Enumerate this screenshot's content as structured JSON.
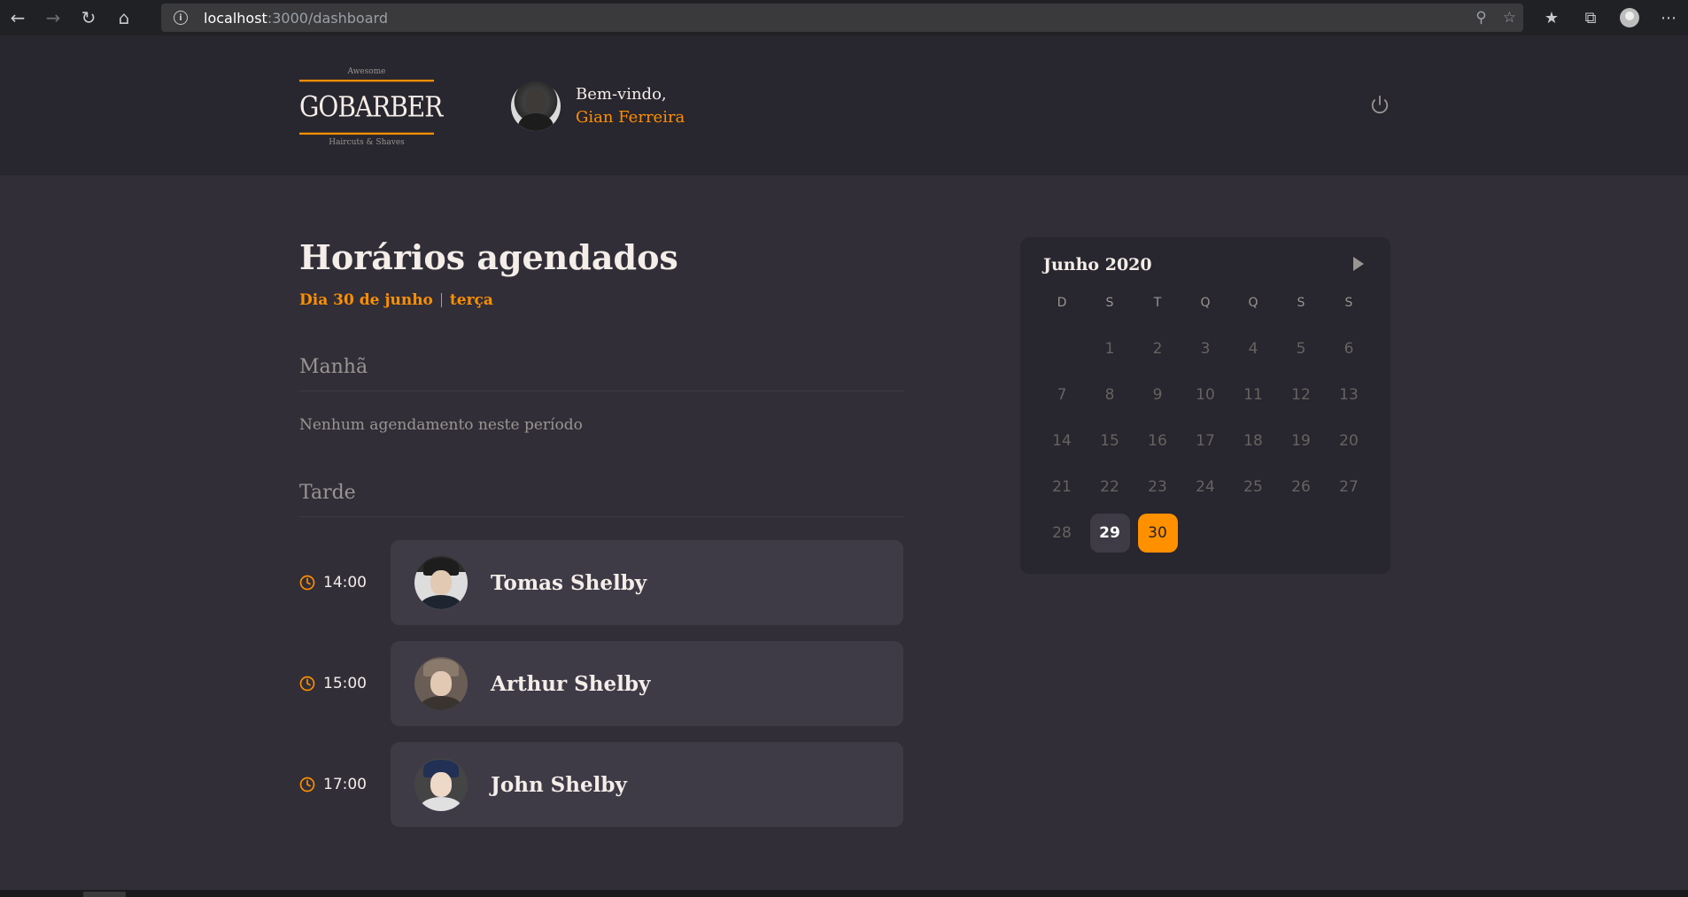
{
  "browser": {
    "url_host": "localhost",
    "url_path": ":3000/dashboard"
  },
  "logo": {
    "top_text": "Awesome",
    "brand": "GOBARBER",
    "bottom_text": "Haircuts & Shaves"
  },
  "header": {
    "greeting": "Bem-vindo,",
    "user_name": "Gian Ferreira"
  },
  "main": {
    "title": "Horários agendados",
    "date_label": "Dia 30 de junho",
    "weekday_label": "terça",
    "morning": {
      "title": "Manhã",
      "empty_message": "Nenhum agendamento neste período"
    },
    "afternoon": {
      "title": "Tarde",
      "appointments": [
        {
          "time": "14:00",
          "name": "Tomas Shelby"
        },
        {
          "time": "15:00",
          "name": "Arthur Shelby"
        },
        {
          "time": "17:00",
          "name": "John Shelby"
        }
      ]
    }
  },
  "calendar": {
    "month_label": "Junho 2020",
    "weekdays": [
      "D",
      "S",
      "T",
      "Q",
      "Q",
      "S",
      "S"
    ],
    "days": [
      {
        "n": "",
        "state": "blank"
      },
      {
        "n": "1",
        "state": "disabled"
      },
      {
        "n": "2",
        "state": "disabled"
      },
      {
        "n": "3",
        "state": "disabled"
      },
      {
        "n": "4",
        "state": "disabled"
      },
      {
        "n": "5",
        "state": "disabled"
      },
      {
        "n": "6",
        "state": "disabled"
      },
      {
        "n": "7",
        "state": "disabled"
      },
      {
        "n": "8",
        "state": "disabled"
      },
      {
        "n": "9",
        "state": "disabled"
      },
      {
        "n": "10",
        "state": "disabled"
      },
      {
        "n": "11",
        "state": "disabled"
      },
      {
        "n": "12",
        "state": "disabled"
      },
      {
        "n": "13",
        "state": "disabled"
      },
      {
        "n": "14",
        "state": "disabled"
      },
      {
        "n": "15",
        "state": "disabled"
      },
      {
        "n": "16",
        "state": "disabled"
      },
      {
        "n": "17",
        "state": "disabled"
      },
      {
        "n": "18",
        "state": "disabled"
      },
      {
        "n": "19",
        "state": "disabled"
      },
      {
        "n": "20",
        "state": "disabled"
      },
      {
        "n": "21",
        "state": "disabled"
      },
      {
        "n": "22",
        "state": "disabled"
      },
      {
        "n": "23",
        "state": "disabled"
      },
      {
        "n": "24",
        "state": "disabled"
      },
      {
        "n": "25",
        "state": "disabled"
      },
      {
        "n": "26",
        "state": "disabled"
      },
      {
        "n": "27",
        "state": "disabled"
      },
      {
        "n": "28",
        "state": "disabled"
      },
      {
        "n": "29",
        "state": "available"
      },
      {
        "n": "30",
        "state": "selected"
      }
    ]
  },
  "colors": {
    "accent": "#ff9000",
    "background": "#312e38",
    "header_bg": "#28262e",
    "card_bg": "#3e3b47",
    "muted_text": "#999591",
    "text": "#f4ede8"
  }
}
